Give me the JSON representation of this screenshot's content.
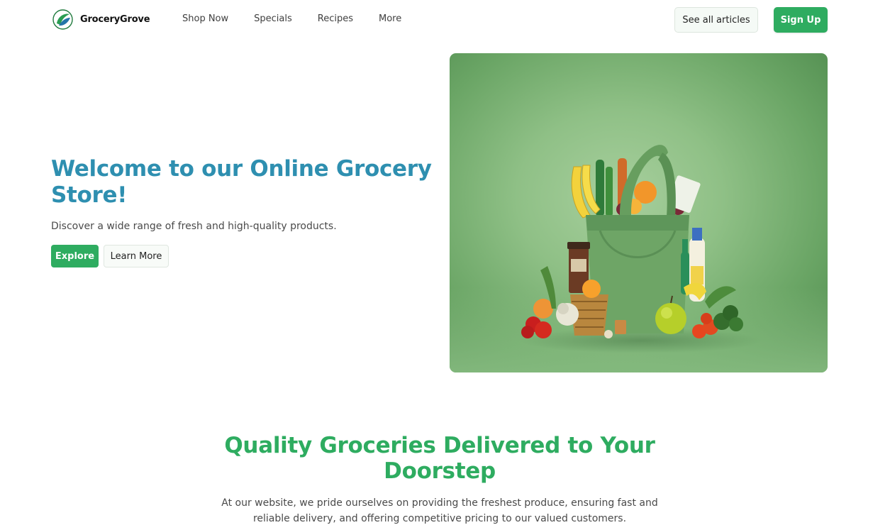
{
  "brand": {
    "name": "GroceryGrove",
    "logo_icon": "leaf-globe-icon"
  },
  "nav": {
    "links": [
      "Shop Now",
      "Specials",
      "Recipes",
      "More"
    ],
    "articles_label": "See all articles",
    "signup_label": "Sign Up"
  },
  "hero": {
    "title": "Welcome to our Online Grocery Store!",
    "subtitle": "Discover a wide range of fresh and high-quality products.",
    "explore_label": "Explore",
    "learn_label": "Learn More",
    "image_subject": "grocery-bag-with-produce-image"
  },
  "section": {
    "title": "Quality Groceries Delivered to Your Doorstep",
    "body": "At our website, we pride ourselves on providing the freshest produce, ensuring fast and reliable delivery, and offering competitive pricing to our valued customers."
  },
  "colors": {
    "accent_green": "#2eac60",
    "hero_title_blue": "#2e8fb0",
    "image_background": "#8fc086"
  }
}
